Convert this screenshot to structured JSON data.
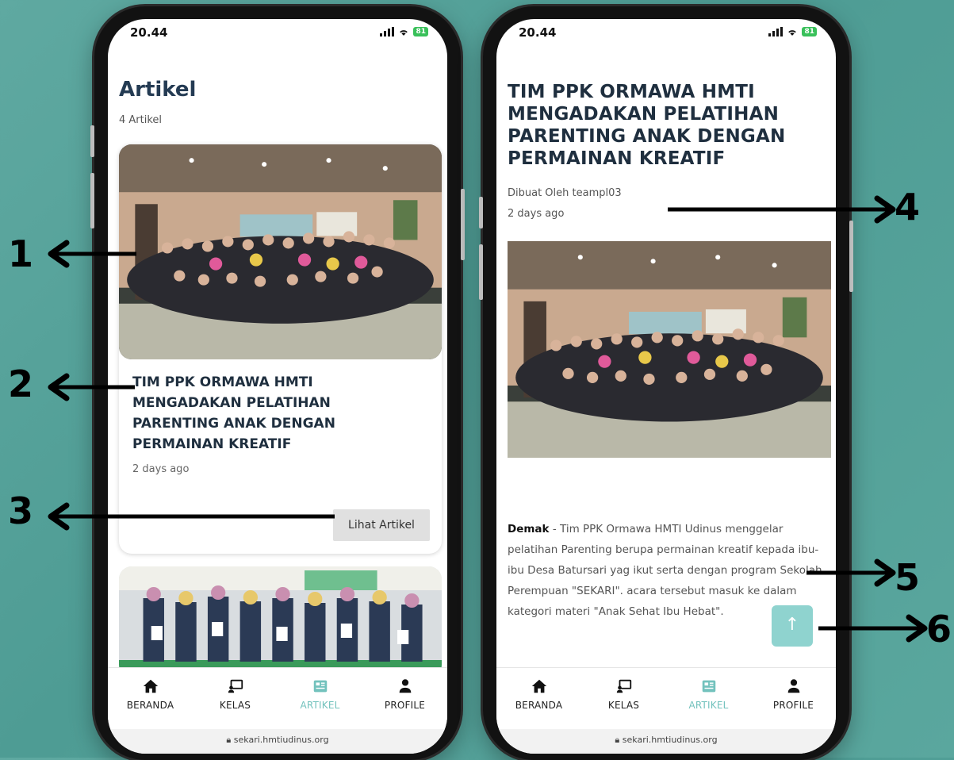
{
  "left_screen": {
    "status": {
      "time": "20.44",
      "battery": "81"
    },
    "page_title": "Artikel",
    "article_count": "4 Artikel",
    "card": {
      "title": "TIM PPK ORMAWA HMTI MENGADAKAN PELATIHAN PARENTING ANAK DENGAN PERMAINAN KREATIF",
      "date": "2 days ago",
      "button_label": "Lihat Artikel"
    }
  },
  "right_screen": {
    "status": {
      "time": "20.44",
      "battery": "81"
    },
    "article": {
      "title": "TIM PPK ORMAWA HMTI MENGADAKAN PELATIHAN PARENTING ANAK DENGAN PERMAINAN KREATIF",
      "author": "Dibuat Oleh teampl03",
      "date": "2 days ago",
      "body_lead": "Demak",
      "body_text": " - Tim PPK Ormawa HMTI Udinus menggelar pelatihan Parenting berupa permainan kreatif kepada ibu-ibu Desa Batursari yag ikut serta dengan program Sekolah Perempuan \"SEKARI\". acara tersebut masuk ke dalam kategori materi \"Anak Sehat Ibu Hebat\"."
    },
    "scroll_top_icon": "arrow-up-icon"
  },
  "nav": {
    "items": [
      {
        "label": "BERANDA",
        "icon": "home-icon"
      },
      {
        "label": "KELAS",
        "icon": "class-icon"
      },
      {
        "label": "ARTIKEL",
        "icon": "article-icon"
      },
      {
        "label": "PROFILE",
        "icon": "profile-icon"
      }
    ],
    "active_color": "#73c2bd"
  },
  "url": "sekari.hmtiudinus.org",
  "annotations": [
    "1",
    "2",
    "3",
    "4",
    "5",
    "6"
  ],
  "colors": {
    "background": "#55a299",
    "accent": "#73c2bd",
    "scroll_button": "#8fd3cf"
  }
}
